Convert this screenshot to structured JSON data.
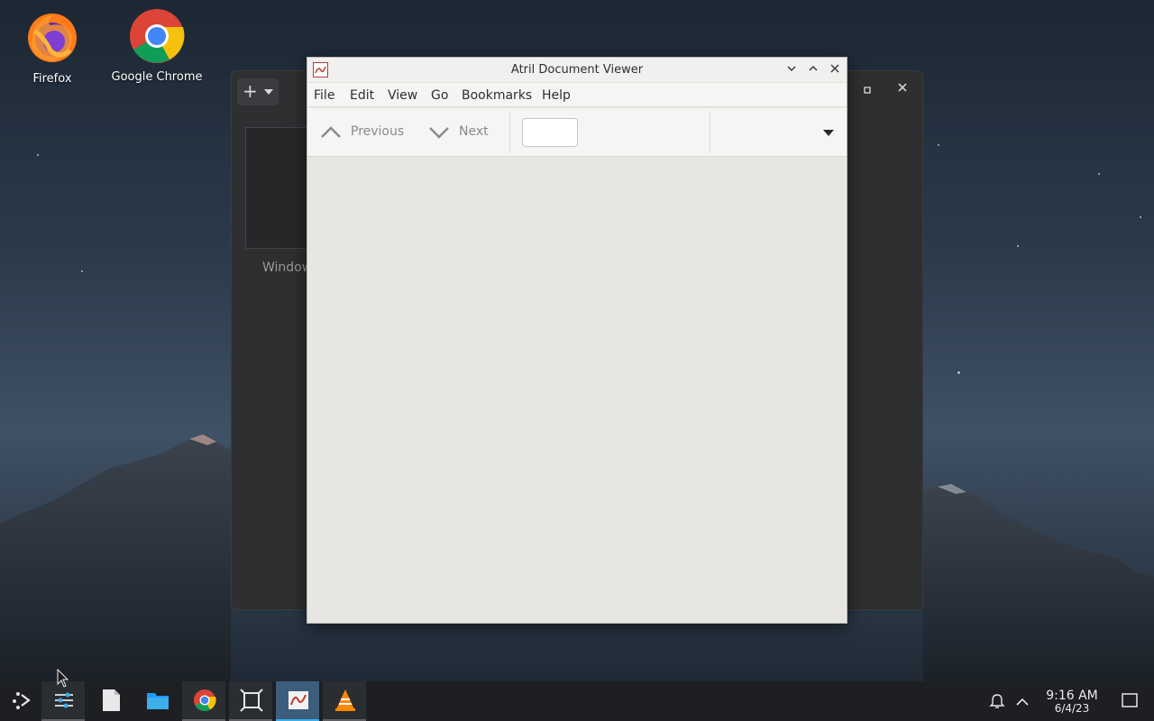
{
  "desktop": {
    "icons": [
      {
        "label": "Firefox",
        "icon": "firefox-icon"
      },
      {
        "label": "Google Chrome",
        "icon": "chrome-icon"
      }
    ]
  },
  "background_window": {
    "new_button": "+",
    "label": "Window"
  },
  "atril": {
    "title": "Atril Document Viewer",
    "menu": [
      "File",
      "Edit",
      "View",
      "Go",
      "Bookmarks",
      "Help"
    ],
    "toolbar": {
      "previous_label": "Previous",
      "next_label": "Next",
      "page_value": "",
      "zoom_value": ""
    }
  },
  "taskbar": {
    "apps": [
      {
        "name": "app-launcher",
        "icon": "launcher-icon"
      },
      {
        "name": "settings",
        "icon": "settings-icon"
      },
      {
        "name": "text-editor",
        "icon": "document-icon"
      },
      {
        "name": "file-manager",
        "icon": "folder-icon"
      },
      {
        "name": "chrome",
        "icon": "chrome-icon"
      },
      {
        "name": "window-overview",
        "icon": "overview-icon"
      },
      {
        "name": "atril",
        "icon": "atril-icon"
      },
      {
        "name": "vlc",
        "icon": "vlc-icon"
      }
    ],
    "clock": {
      "time": "9:16 AM",
      "date": "6/4/23"
    }
  },
  "colors": {
    "accent": "#3daee9",
    "taskbar": "#1d1f22",
    "atril_bg": "#e8e6e3"
  }
}
